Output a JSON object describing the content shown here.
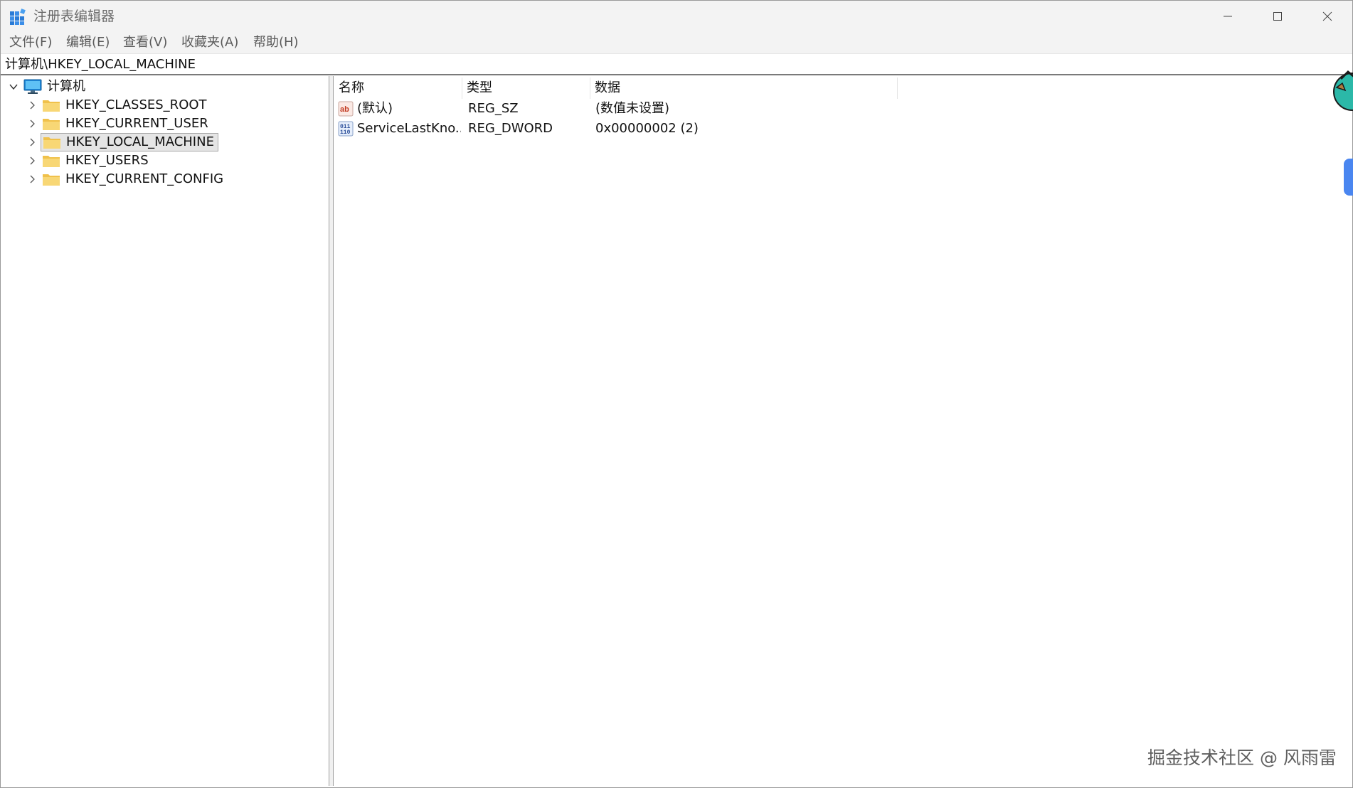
{
  "window": {
    "title": "注册表编辑器"
  },
  "menu": [
    {
      "label": "文件(F)"
    },
    {
      "label": "编辑(E)"
    },
    {
      "label": "查看(V)"
    },
    {
      "label": "收藏夹(A)"
    },
    {
      "label": "帮助(H)"
    }
  ],
  "address": {
    "path": "计算机\\HKEY_LOCAL_MACHINE"
  },
  "tree": {
    "root": {
      "label": "计算机",
      "expanded": true
    },
    "items": [
      {
        "label": "HKEY_CLASSES_ROOT",
        "selected": false
      },
      {
        "label": "HKEY_CURRENT_USER",
        "selected": false
      },
      {
        "label": "HKEY_LOCAL_MACHINE",
        "selected": true
      },
      {
        "label": "HKEY_USERS",
        "selected": false
      },
      {
        "label": "HKEY_CURRENT_CONFIG",
        "selected": false
      }
    ]
  },
  "list": {
    "columns": [
      {
        "label": "名称"
      },
      {
        "label": "类型"
      },
      {
        "label": "数据"
      }
    ],
    "rows": [
      {
        "icon": "string-value-icon",
        "name": "(默认)",
        "type": "REG_SZ",
        "data": "(数值未设置)"
      },
      {
        "icon": "binary-value-icon",
        "name": "ServiceLastKno...",
        "type": "REG_DWORD",
        "data": "0x00000002 (2)"
      }
    ]
  },
  "watermark": "掘金技术社区 @ 风雨雷",
  "colors": {
    "accent": "#0078d4",
    "folder": "#f6d36b",
    "selection": "#e5e5e5"
  }
}
